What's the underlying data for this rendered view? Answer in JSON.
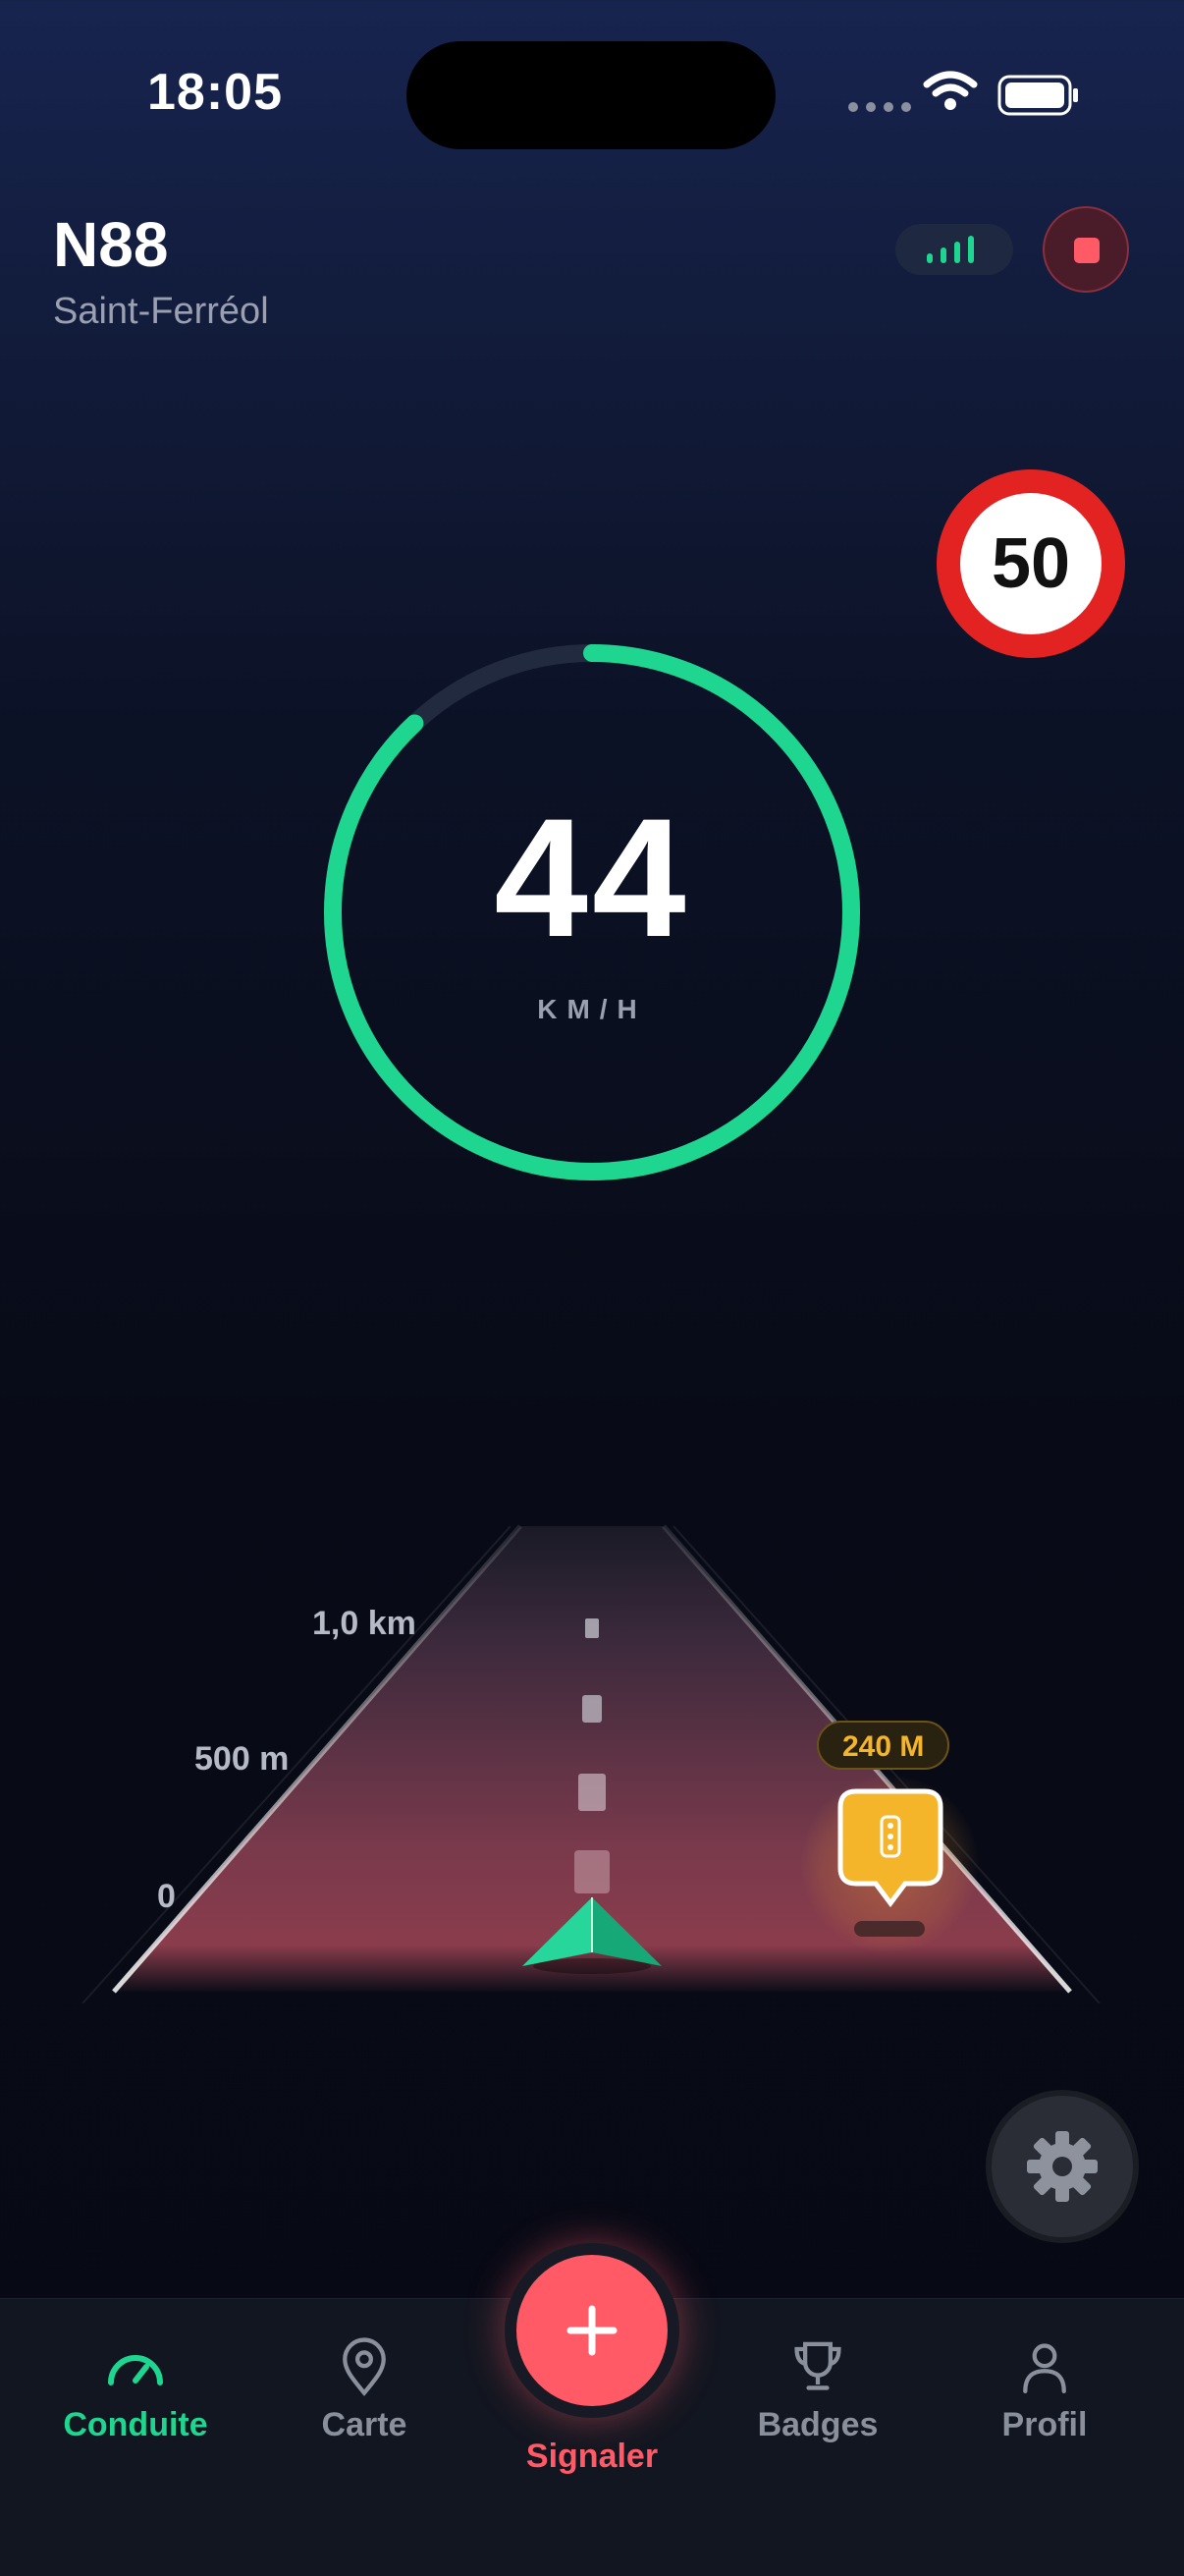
{
  "status_bar": {
    "time": "18:05"
  },
  "header": {
    "road": "N88",
    "town": "Saint-Ferréol"
  },
  "speed_limit": "50",
  "speed": {
    "value": "44",
    "unit": "KM/H",
    "gauge_fraction": 0.88
  },
  "road_view": {
    "distance_labels": [
      "1,0 km",
      "500 m",
      "0"
    ],
    "hazard": {
      "distance": "240 M",
      "icon": "traffic-light-icon"
    }
  },
  "tabs": [
    {
      "label": "Conduite",
      "icon": "speedometer-icon",
      "active": true
    },
    {
      "label": "Carte",
      "icon": "map-pin-icon"
    },
    {
      "label": "Signaler",
      "icon": "plus-icon"
    },
    {
      "label": "Badges",
      "icon": "trophy-icon"
    },
    {
      "label": "Profil",
      "icon": "user-icon"
    }
  ],
  "colors": {
    "accent": "#1ed68f",
    "report": "#ff5a66",
    "hazard": "#f5b52a",
    "limit_ring": "#e32222"
  }
}
